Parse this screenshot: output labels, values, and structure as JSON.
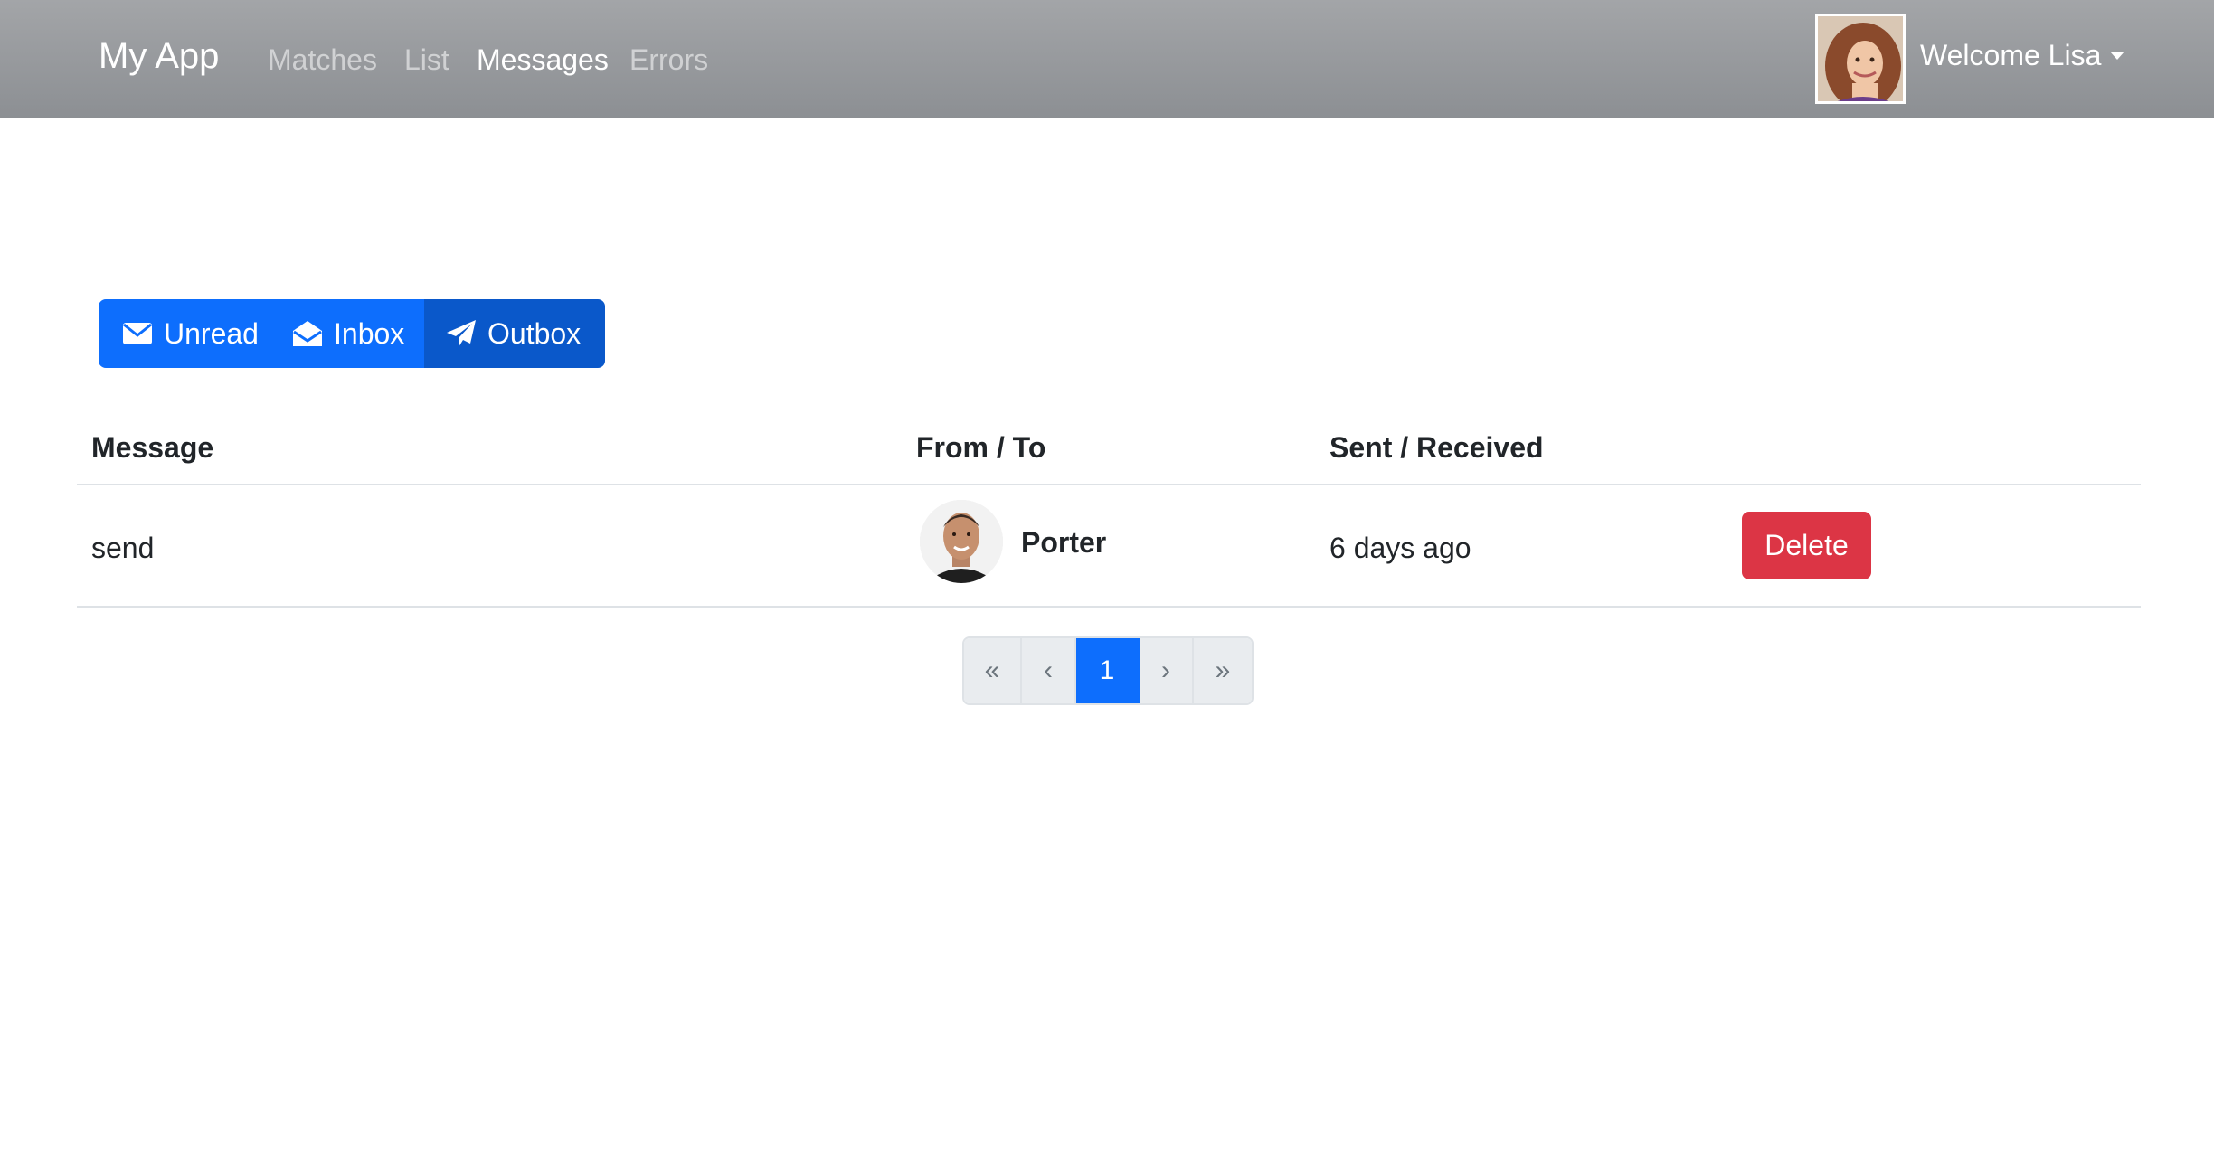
{
  "nav": {
    "brand": "My App",
    "links": [
      {
        "label": "Matches",
        "active": false
      },
      {
        "label": "List",
        "active": false
      },
      {
        "label": "Messages",
        "active": true
      },
      {
        "label": "Errors",
        "active": false
      }
    ],
    "welcome": "Welcome Lisa"
  },
  "tabs": {
    "unread": "Unread",
    "inbox": "Inbox",
    "outbox": "Outbox",
    "active": "Outbox"
  },
  "table": {
    "headers": [
      "Message",
      "From / To",
      "Sent / Received"
    ],
    "rows": [
      {
        "message": "send",
        "user": "Porter",
        "when": "6 days ago",
        "action": "Delete"
      }
    ]
  },
  "pagination": {
    "first": "«",
    "prev": "‹",
    "pages": [
      "1"
    ],
    "current": "1",
    "next": "›",
    "last": "»"
  },
  "colors": {
    "primary": "#0d6efd",
    "primary_active": "#0a58ca",
    "danger": "#dc3545",
    "navbar": "#999b9e"
  }
}
